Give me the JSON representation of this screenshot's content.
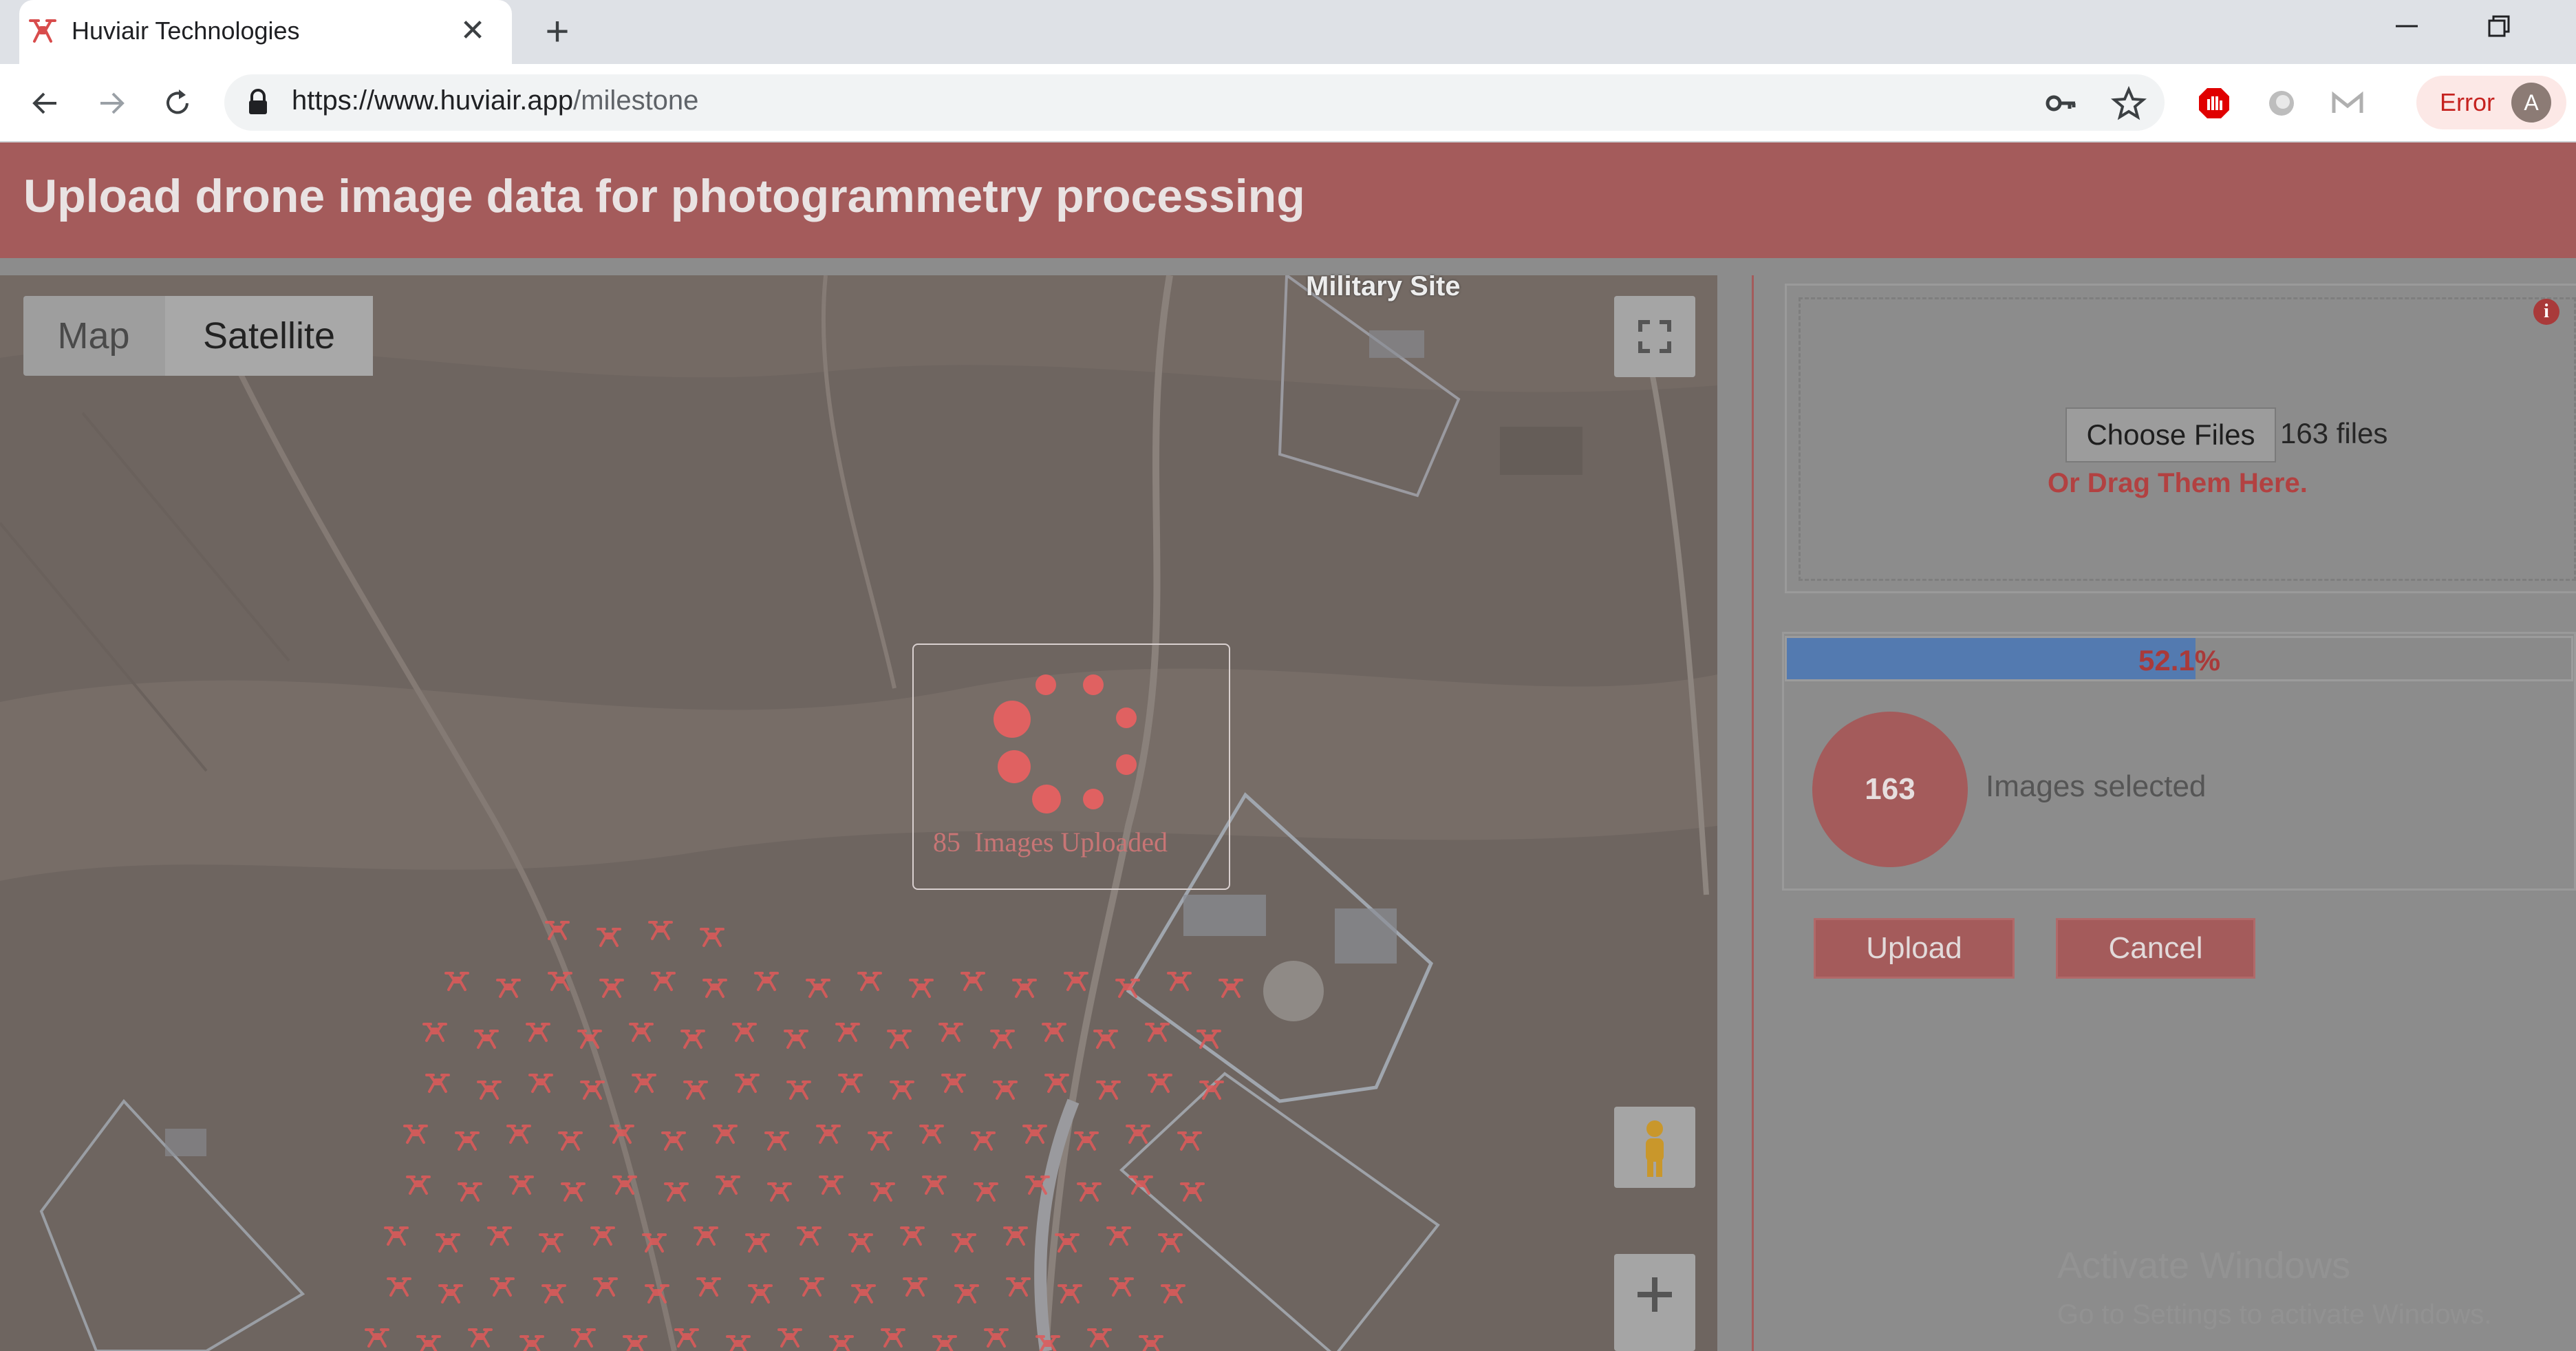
{
  "browser": {
    "tab_title": "Huviair Technologies",
    "tab_close": "✕",
    "new_tab": "+",
    "url_host": "https://www.huviair.app",
    "url_path": "/milestone",
    "profile_label": "Error",
    "avatar_letter": "A"
  },
  "header": {
    "title": "Upload drone image data for photogrammetry processing"
  },
  "map": {
    "type_map_label": "Map",
    "type_satellite_label": "Satellite",
    "selected_type": "Satellite",
    "place_label": "Military Site",
    "upload_overlay_count": "85",
    "upload_overlay_text": "Images Uploaded"
  },
  "uploader": {
    "choose_button": "Choose Files",
    "file_count": "163 files",
    "drag_hint": "Or Drag Them Here.",
    "progress_label": "52.1%",
    "progress_fraction": 0.521,
    "selected_count": "163",
    "selected_label": "Images selected",
    "upload_button": "Upload",
    "cancel_button": "Cancel"
  },
  "watermark": {
    "title": "Activate Windows",
    "subtitle": "Go to Settings to activate Windows."
  },
  "colors": {
    "brand": "#a45b5b",
    "accent_text": "#b24141",
    "progress_fill": "#537ab0",
    "drone_marker": "#e05a5a"
  },
  "icons": [
    "drone-favicon-icon",
    "close-icon",
    "plus-icon",
    "back-icon",
    "forward-icon",
    "reload-icon",
    "lock-icon",
    "key-icon",
    "star-icon",
    "adblock-icon",
    "extension-icon",
    "gmail-icon",
    "fullscreen-icon",
    "pegman-icon",
    "zoom-in-icon",
    "info-icon",
    "drone-marker-icon"
  ]
}
